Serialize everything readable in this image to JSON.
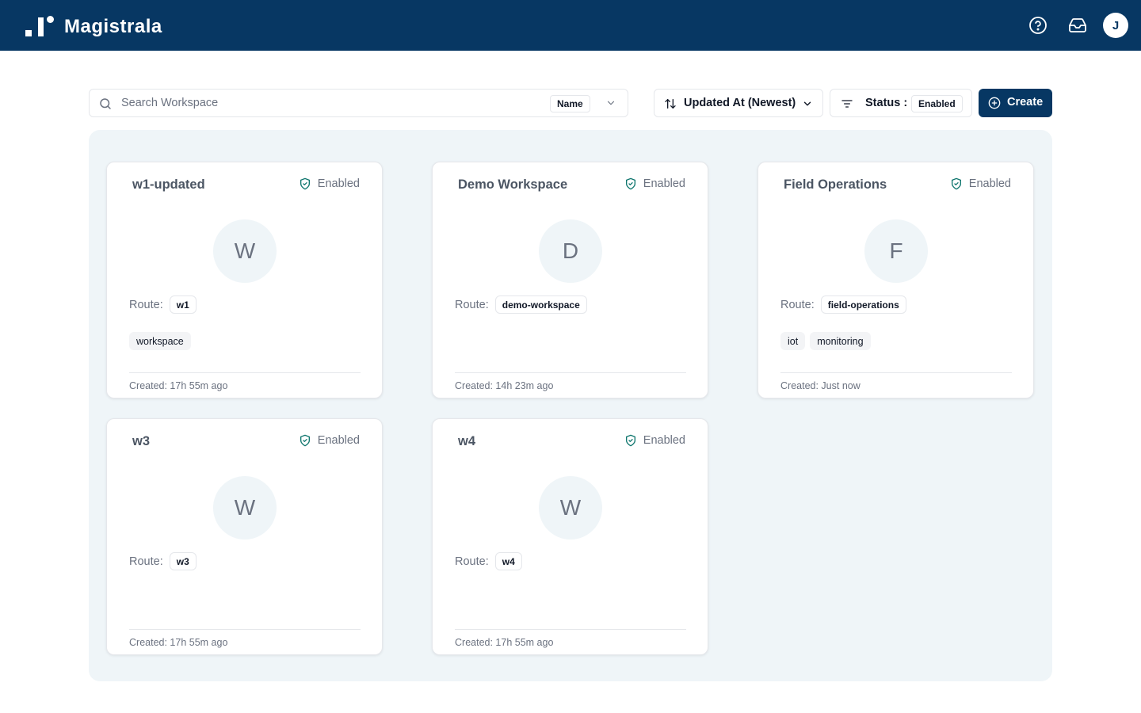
{
  "app": {
    "name": "Magistrala"
  },
  "header": {
    "user_initial": "J"
  },
  "toolbar": {
    "search_placeholder": "Search Workspace",
    "search_field": "Name",
    "sort_label": "Updated At (Newest)",
    "status_label": "Status :",
    "status_value": "Enabled",
    "create_label": "Create"
  },
  "colors": {
    "brand": "#073763",
    "panel": "#eff5f8",
    "status_icon": "#0f766e"
  },
  "workspaces": [
    {
      "name": "w1-updated",
      "status": "Enabled",
      "initial": "W",
      "route_label": "Route:",
      "route": "w1",
      "tags": [
        "workspace"
      ],
      "created": "Created: 17h 55m ago"
    },
    {
      "name": "Demo Workspace",
      "status": "Enabled",
      "initial": "D",
      "route_label": "Route:",
      "route": "demo-workspace",
      "tags": [],
      "created": "Created: 14h 23m ago"
    },
    {
      "name": "Field Operations",
      "status": "Enabled",
      "initial": "F",
      "route_label": "Route:",
      "route": "field-operations",
      "tags": [
        "iot",
        "monitoring"
      ],
      "created": "Created: Just now"
    },
    {
      "name": "w3",
      "status": "Enabled",
      "initial": "W",
      "route_label": "Route:",
      "route": "w3",
      "tags": [],
      "created": "Created: 17h 55m ago"
    },
    {
      "name": "w4",
      "status": "Enabled",
      "initial": "W",
      "route_label": "Route:",
      "route": "w4",
      "tags": [],
      "created": "Created: 17h 55m ago"
    }
  ]
}
